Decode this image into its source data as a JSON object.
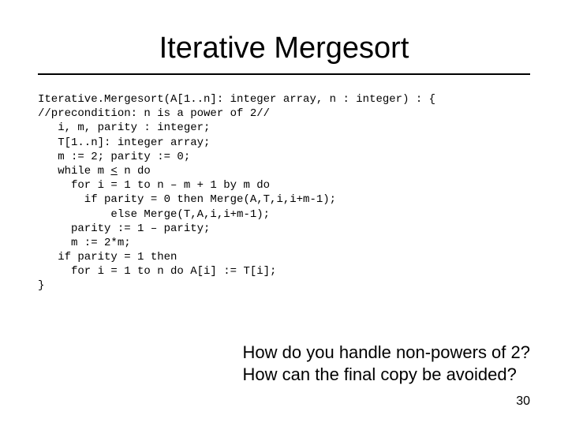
{
  "title": "Iterative Mergesort",
  "code": {
    "l1a": "Iterative.Mergesort(A[1..n]: integer array, n : integer) : {",
    "l2": "//precondition: n is a power of 2//",
    "l3": "   i, m, parity : integer;",
    "l4": "   T[1..n]: integer array;",
    "l5": "   m := 2; parity := 0;",
    "l6a": "   while m ",
    "l6u": "<",
    "l6b": " n do",
    "l7": "     for i = 1 to n – m + 1 by m do",
    "l8": "       if parity = 0 then Merge(A,T,i,i+m-1);",
    "l9": "           else Merge(T,A,i,i+m-1);",
    "l10": "     parity := 1 – parity;",
    "l11": "     m := 2*m;",
    "l12": "   if parity = 1 then",
    "l13": "     for i = 1 to n do A[i] := T[i];",
    "l14": "}"
  },
  "questions": {
    "q1": "How do you handle non-powers of 2?",
    "q2": "How can the final copy be avoided?"
  },
  "page": "30"
}
